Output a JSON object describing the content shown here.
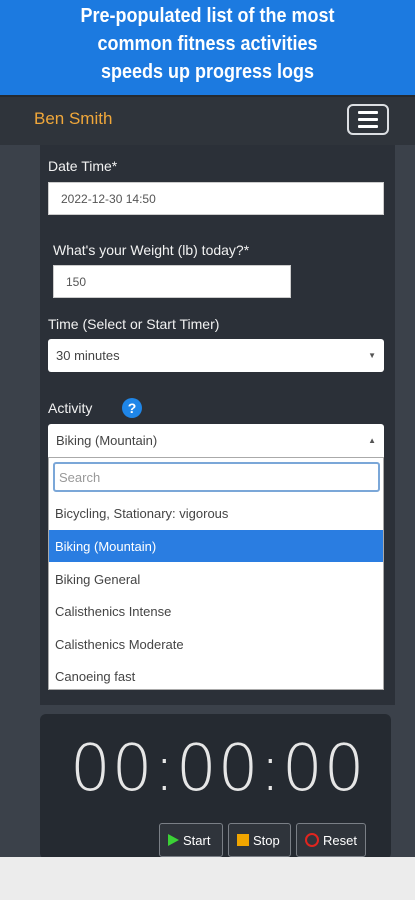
{
  "banner": {
    "line1": "Pre-populated list of the most",
    "line2": "common fitness activities",
    "line3": "speeds up progress logs"
  },
  "navbar": {
    "user_name": "Ben Smith"
  },
  "form": {
    "datetime_label": "Date Time*",
    "datetime_value": "2022-12-30 14:50",
    "weight_label": "What's your Weight (lb) today?*",
    "weight_value": "150",
    "time_label": "Time (Select or Start Timer)",
    "time_selected": "30 minutes",
    "activity_label": "Activity",
    "activity_selected": "Biking (Mountain)"
  },
  "dropdown": {
    "search_placeholder": "Search",
    "options": [
      "Bicycling, Stationary: vigorous",
      "Biking (Mountain)",
      "Biking General",
      "Calisthenics Intense",
      "Calisthenics Moderate",
      "Canoeing fast"
    ]
  },
  "timer": {
    "display": "00:00:00",
    "start_label": "Start",
    "stop_label": "Stop",
    "reset_label": "Reset"
  },
  "colors": {
    "banner": "#1c7ae0",
    "brand": "#f0a73a",
    "selected_option": "#2a7de1",
    "start_icon": "#3bd136",
    "stop_icon": "#f0a500",
    "reset_icon": "#e0251f"
  }
}
